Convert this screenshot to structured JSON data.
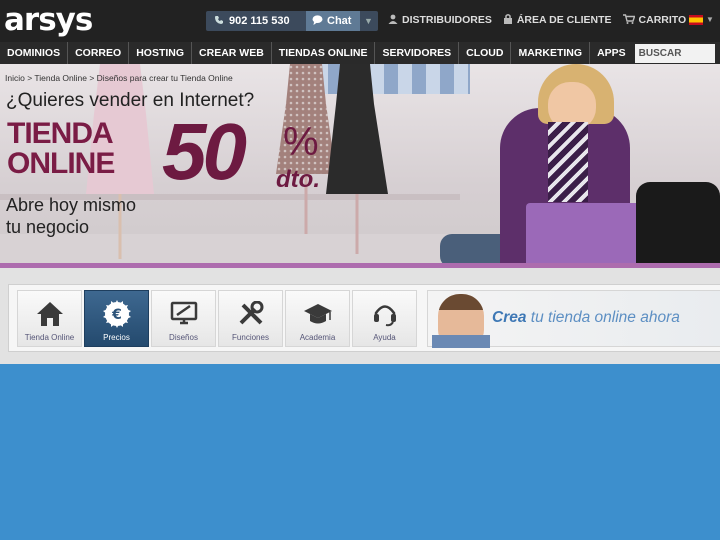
{
  "header": {
    "logo": "arsys",
    "phone": "902 115 530",
    "chat_label": "Chat",
    "links": [
      {
        "icon": "person-icon",
        "label": "DISTRIBUIDORES"
      },
      {
        "icon": "lock-icon",
        "label": "ÁREA DE CLIENTE"
      },
      {
        "icon": "cart-icon",
        "label": "CARRITO"
      }
    ]
  },
  "nav": {
    "items": [
      "DOMINIOS",
      "CORREO",
      "HOSTING",
      "CREAR WEB",
      "TIENDAS ONLINE",
      "SERVIDORES",
      "CLOUD",
      "MARKETING",
      "APPS"
    ],
    "search_placeholder": "BUSCAR"
  },
  "banner": {
    "breadcrumb": "Inicio > Tienda Online > Diseños para crear tu Tienda Online",
    "question": "¿Quieres vender en Internet?",
    "title_line1": "TIENDA",
    "title_line2": "ONLINE",
    "discount_value": "50",
    "discount_symbol": "%",
    "discount_suffix": "dto.",
    "cta_line1": "Abre hoy mismo",
    "cta_line2": "tu negocio",
    "colors": {
      "brand": "#6d1a41",
      "accent": "#ad6cae"
    }
  },
  "menu": {
    "tabs": [
      {
        "icon": "home-icon",
        "label": "Tienda Online",
        "active": false
      },
      {
        "icon": "euro-icon",
        "label": "Precios",
        "active": true
      },
      {
        "icon": "design-icon",
        "label": "Diseños",
        "active": false
      },
      {
        "icon": "tools-icon",
        "label": "Funciones",
        "active": false
      },
      {
        "icon": "graduation-cap-icon",
        "label": "Academia",
        "active": false
      },
      {
        "icon": "headset-icon",
        "label": "Ayuda",
        "active": false
      }
    ],
    "promo": {
      "bold": "Crea",
      "rest": "tu tienda online ahora"
    }
  }
}
